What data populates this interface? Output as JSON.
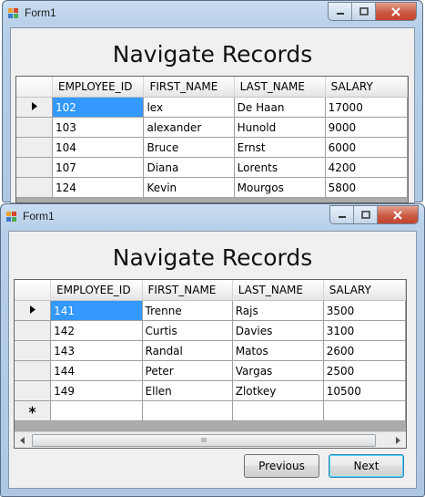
{
  "window1": {
    "title": "Form1",
    "heading": "Navigate Records",
    "columns": [
      "EMPLOYEE_ID",
      "FIRST_NAME",
      "LAST_NAME",
      "SALARY"
    ],
    "rows": [
      [
        "102",
        "lex",
        "De Haan",
        "17000"
      ],
      [
        "103",
        "alexander",
        "Hunold",
        "9000"
      ],
      [
        "104",
        "Bruce",
        "Ernst",
        "6000"
      ],
      [
        "107",
        "Diana",
        "Lorents",
        "4200"
      ],
      [
        "124",
        "Kevin",
        "Mourgos",
        "5800"
      ]
    ]
  },
  "window2": {
    "title": "Form1",
    "heading": "Navigate Records",
    "columns": [
      "EMPLOYEE_ID",
      "FIRST_NAME",
      "LAST_NAME",
      "SALARY"
    ],
    "rows": [
      [
        "141",
        "Trenne",
        "Rajs",
        "3500"
      ],
      [
        "142",
        "Curtis",
        "Davies",
        "3100"
      ],
      [
        "143",
        "Randal",
        "Matos",
        "2600"
      ],
      [
        "144",
        "Peter",
        "Vargas",
        "2500"
      ],
      [
        "149",
        "Ellen",
        "Zlotkey",
        "10500"
      ]
    ],
    "previous_label": "Previous",
    "next_label": "Next"
  },
  "icons": {
    "current_row": "current-row-arrow-icon",
    "new_row": "new-row-asterisk-icon",
    "scroll_thumb_grip": "III"
  }
}
